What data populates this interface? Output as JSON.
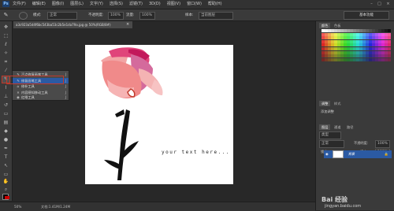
{
  "app": {
    "logo": "Ps"
  },
  "menubar": {
    "items": [
      "文件(F)",
      "编辑(E)",
      "图像(I)",
      "图层(L)",
      "文字(Y)",
      "选择(S)",
      "滤镜(T)",
      "3D(D)",
      "视图(V)",
      "窗口(W)",
      "帮助(H)"
    ],
    "window_buttons": [
      "–",
      "□",
      "×"
    ]
  },
  "options_bar": {
    "mode_label": "模式:",
    "mode_value": "正常",
    "opacity_label": "不透明度:",
    "opacity_value": "100%",
    "flow_label": "流量:",
    "flow_value": "100%",
    "sample_label": "样本:",
    "sample_value": "当前图层",
    "workspace": "基本功能"
  },
  "document": {
    "tab_title": "a3c923a5d4f6bc543ba53c2b5e1da79a.jpg @ 50%(RGB/8#)",
    "canvas_caption": "your text here..."
  },
  "flyout": {
    "items": [
      {
        "icon": "spot-healing-brush-icon",
        "glyph": "✎",
        "label": "污点修复画笔工具",
        "key": "J"
      },
      {
        "icon": "healing-brush-icon",
        "glyph": "✎",
        "label": "修复画笔工具",
        "key": "J"
      },
      {
        "icon": "patch-icon",
        "glyph": "⌂",
        "label": "修补工具",
        "key": "J"
      },
      {
        "icon": "content-aware-move-icon",
        "glyph": "✕",
        "label": "内容感知移动工具",
        "key": "J"
      },
      {
        "icon": "red-eye-icon",
        "glyph": "◉",
        "label": "红眼工具",
        "key": "J"
      }
    ],
    "selected_index": 1
  },
  "status_bar": {
    "zoom": "50%",
    "doc_info": "文档:1.41M/1.24M"
  },
  "panels": {
    "top_tabs": [
      "颜色",
      "色板"
    ],
    "mid_tabs": [
      "调整",
      "样式"
    ],
    "mid_label": "添加调整",
    "layer_tabs": [
      "图层",
      "通道",
      "路径"
    ],
    "layer_kind": "类型",
    "blend_mode": "正常",
    "opacity_label": "不透明度:",
    "opacity_value": "100%",
    "lock_label": "锁定:",
    "fill_label": "填充:",
    "fill_value": "100%",
    "layer_name": "背景"
  },
  "watermark": {
    "brand": "Bai 经验",
    "url": "jingyan.baidu.com"
  },
  "colors": {
    "accent_highlight": "#c0392b",
    "selection": "#2b5aa3",
    "foreground": "#000000",
    "background": "#ffffff"
  }
}
